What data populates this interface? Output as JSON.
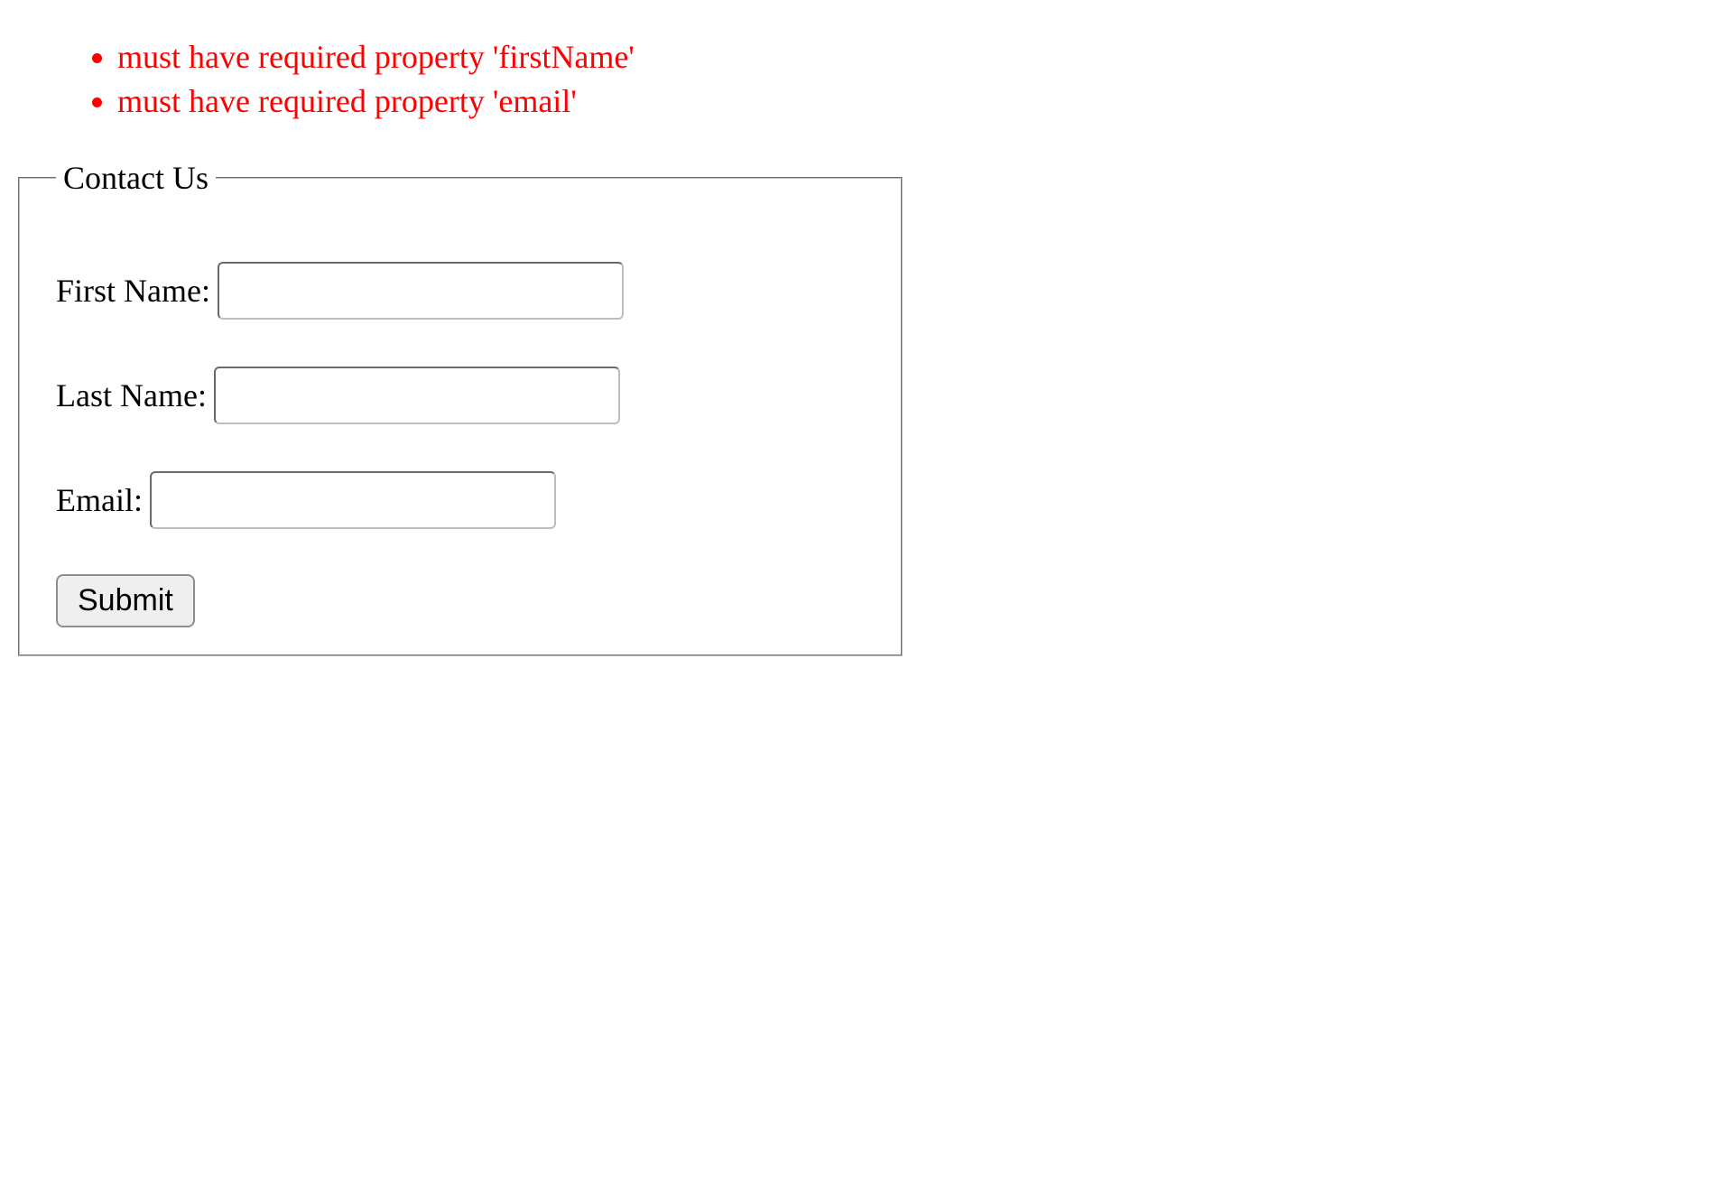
{
  "errors": [
    "must have required property 'firstName'",
    "must have required property 'email'"
  ],
  "form": {
    "legend": "Contact Us",
    "firstName": {
      "label": "First Name:",
      "value": ""
    },
    "lastName": {
      "label": "Last Name:",
      "value": ""
    },
    "email": {
      "label": "Email:",
      "value": ""
    },
    "submitLabel": "Submit"
  },
  "colors": {
    "error": "#ff0000"
  }
}
